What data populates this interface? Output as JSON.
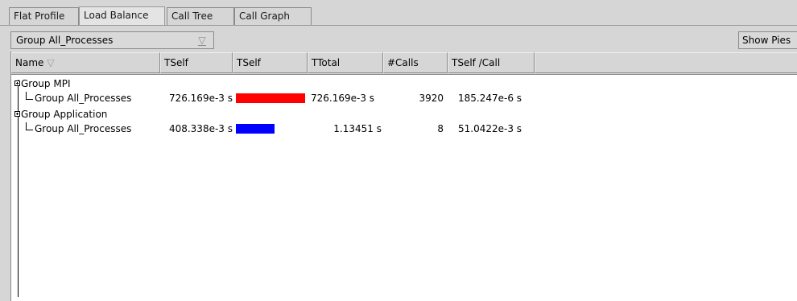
{
  "tabs": [
    {
      "label": "Flat Profile",
      "active": false
    },
    {
      "label": "Load Balance",
      "active": true
    },
    {
      "label": "Call Tree",
      "active": false
    },
    {
      "label": "Call Graph",
      "active": false
    }
  ],
  "toolbar": {
    "group_select": "Group All_Processes",
    "show_pies_label": "Show Pies"
  },
  "columns": [
    "Name",
    "TSelf",
    "TSelf",
    "TTotal",
    "#Calls",
    "TSelf /Call"
  ],
  "rows": [
    {
      "name": "Group MPI",
      "level": 0
    },
    {
      "name": "Group All_Processes",
      "level": 1,
      "tself": "726.169e-3 s",
      "bar_fraction": 1.0,
      "bar_color": "#ff0000",
      "ttotal": "726.169e-3 s",
      "calls": "3920",
      "tself_per_call": "185.247e-6 s"
    },
    {
      "name": "Group Application",
      "level": 0
    },
    {
      "name": "Group All_Processes",
      "level": 1,
      "tself": "408.338e-3 s",
      "bar_fraction": 0.5623,
      "bar_color": "#0000ff",
      "ttotal": "1.13451 s",
      "calls": "8",
      "tself_per_call": "51.0422e-3 s"
    }
  ]
}
